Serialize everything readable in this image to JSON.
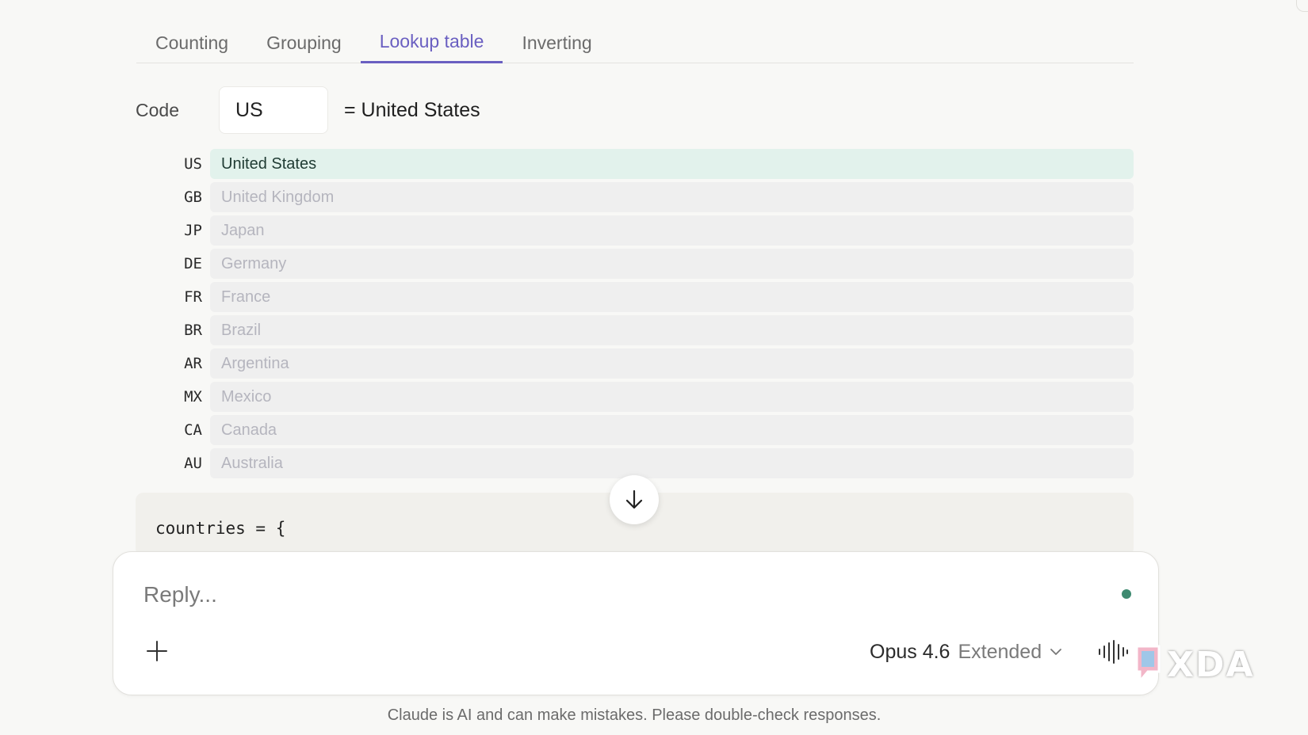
{
  "tabs": [
    {
      "label": "Counting",
      "active": false
    },
    {
      "label": "Grouping",
      "active": false
    },
    {
      "label": "Lookup table",
      "active": true
    },
    {
      "label": "Inverting",
      "active": false
    }
  ],
  "lookup": {
    "code_label": "Code",
    "code_value": "US",
    "result_text": "= United States",
    "rows": [
      {
        "code": "US",
        "name": "United States",
        "active": true
      },
      {
        "code": "GB",
        "name": "United Kingdom",
        "active": false
      },
      {
        "code": "JP",
        "name": "Japan",
        "active": false
      },
      {
        "code": "DE",
        "name": "Germany",
        "active": false
      },
      {
        "code": "FR",
        "name": "France",
        "active": false
      },
      {
        "code": "BR",
        "name": "Brazil",
        "active": false
      },
      {
        "code": "AR",
        "name": "Argentina",
        "active": false
      },
      {
        "code": "MX",
        "name": "Mexico",
        "active": false
      },
      {
        "code": "CA",
        "name": "Canada",
        "active": false
      },
      {
        "code": "AU",
        "name": "Australia",
        "active": false
      }
    ]
  },
  "code_block": {
    "line1": "countries = {"
  },
  "composer": {
    "placeholder": "Reply...",
    "model_name": "Opus 4.6",
    "model_mode": "Extended"
  },
  "disclaimer": "Claude is AI and can make mistakes. Please double-check responses.",
  "watermark": "XDA",
  "icons": {
    "scroll": "arrow-down-icon",
    "add": "plus-icon",
    "model": "chevron-down-icon",
    "voice": "waveform-icon"
  },
  "colors": {
    "accent": "#6a5fc1",
    "active_row": "#e2f2ec",
    "status_dot": "#3e8a70"
  }
}
